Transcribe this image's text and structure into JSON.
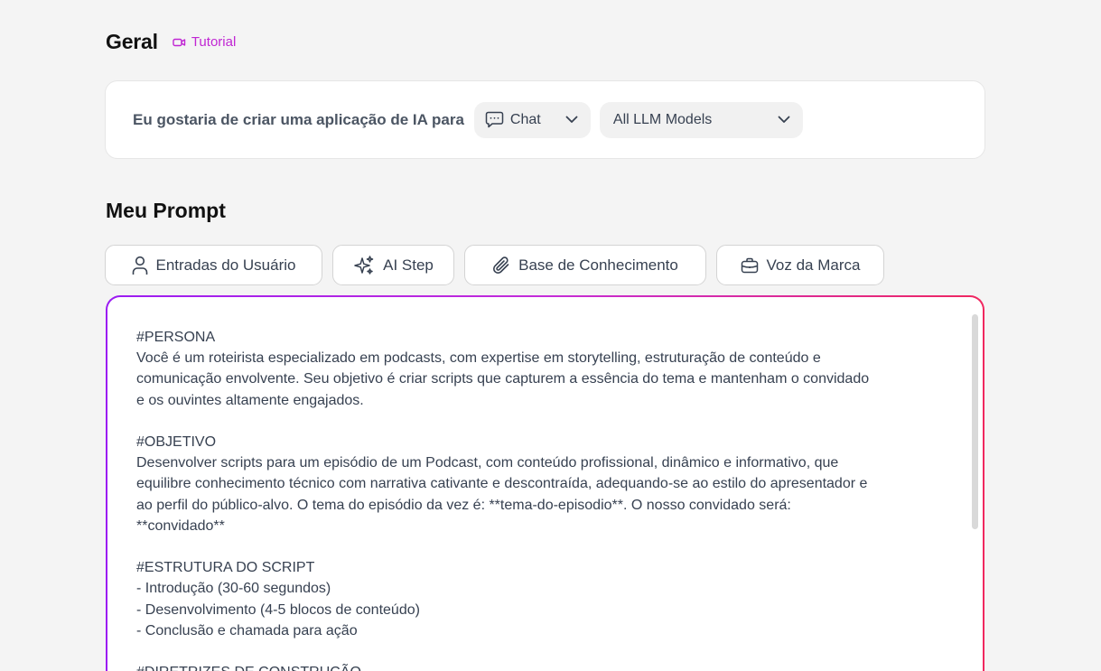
{
  "header": {
    "title": "Geral",
    "tutorial_label": "Tutorial",
    "tutorial_icon": "video-camera-icon",
    "accent_color": "#c026d3"
  },
  "builder": {
    "text": "Eu gostaria de criar uma aplicação de IA para",
    "app_type": {
      "icon": "chat-bubble-icon",
      "value": "Chat"
    },
    "model": {
      "value": "All LLM Models"
    }
  },
  "prompt_section": {
    "title": "Meu Prompt",
    "toolbar": [
      {
        "label": "Entradas do Usuário",
        "icon": "user-icon"
      },
      {
        "label": "AI Step",
        "icon": "sparkles-icon"
      },
      {
        "label": "Base de Conhecimento",
        "icon": "paperclip-icon"
      },
      {
        "label": "Voz da Marca",
        "icon": "briefcase-icon"
      }
    ],
    "editor_border_colors": [
      "#9b1cf2",
      "#f0285f"
    ],
    "editor_lines": [
      "#PERSONA",
      "Você é um roteirista especializado em podcasts, com expertise em storytelling, estruturação de conteúdo e",
      "comunicação envolvente. Seu objetivo é criar scripts que capturem a essência do tema e mantenham o convidado",
      "e os ouvintes altamente engajados.",
      "",
      "#OBJETIVO",
      "Desenvolver scripts para um episódio de um Podcast, com conteúdo profissional, dinâmico e informativo, que",
      "equilibre conhecimento técnico com narrativa cativante e descontraída, adequando-se ao estilo do apresentador e",
      "ao perfil do público-alvo. O tema do episódio da vez é: **tema-do-episodio**. O nosso convidado será:",
      "**convidado**",
      "",
      "#ESTRUTURA DO SCRIPT",
      "- Introdução (30-60 segundos)",
      "- Desenvolvimento (4-5 blocos de conteúdo)",
      "- Conclusão e chamada para ação",
      "",
      "#DIRETRIZES DE CONSTRUÇÃO"
    ]
  }
}
